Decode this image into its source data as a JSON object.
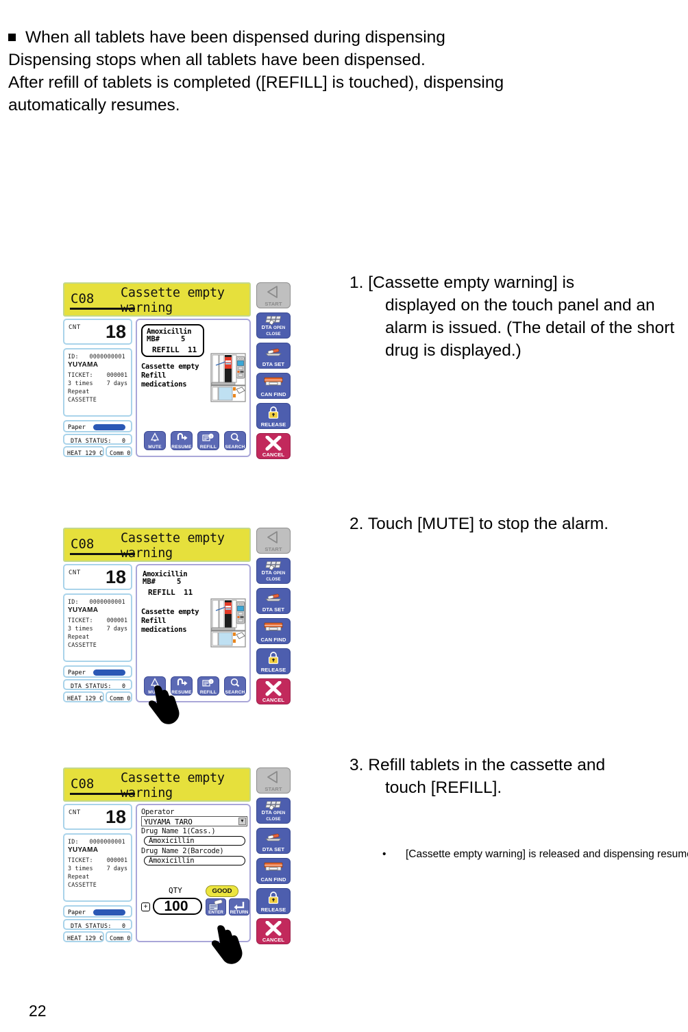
{
  "intro": {
    "bullet_line": "When all tablets have been dispensed during dispensing",
    "line2": "Dispensing stops when all tablets have been dispensed.",
    "line3": "After refill of tablets is completed ([REFILL] is touched), dispensing",
    "line4": "automatically resumes."
  },
  "steps": [
    {
      "number": "1.",
      "first": "[Cassette empty warning] is",
      "rest": "displayed on the touch panel and an alarm is issued.  (The detail of the short drug is displayed.)"
    },
    {
      "number": "2.",
      "first": "Touch [MUTE] to stop the alarm.",
      "rest": ""
    },
    {
      "number": "3.",
      "first": "Refill tablets in the cassette and",
      "rest": "touch [REFILL]."
    }
  ],
  "note": {
    "bullet": "•",
    "text": "[Cassette empty warning] is released and dispensing resumes."
  },
  "screen": {
    "header": {
      "code": "C08",
      "title": "Cassette empty warning"
    },
    "count": {
      "label": "CNT",
      "value": "18"
    },
    "patient": {
      "id_label": "ID:",
      "id_value": "0000000001",
      "name": "YUYAMA",
      "ticket_label": "TICKET:",
      "ticket_value": "000001",
      "times": "3 times",
      "days": "7 days",
      "repeat": "Repeat",
      "cassette": "CASSETTE"
    },
    "status": {
      "paper_label": "Paper",
      "dta_label": "DTA STATUS:",
      "dta_value": "0",
      "heat": "HEAT 129  C",
      "comm": "Comm 0"
    },
    "alert": {
      "drug": "Amoxicillin",
      "mb_label": "MB#",
      "mb_value": "5",
      "refill_label": "REFILL",
      "refill_value": "11",
      "message": "Cassette empty Refill medications"
    },
    "touch_buttons": [
      {
        "label": "MUTE",
        "icon": "bell-icon"
      },
      {
        "label": "RESUME",
        "icon": "resume-arrow-icon"
      },
      {
        "label": "REFILL",
        "icon": "refill-info-icon"
      },
      {
        "label": "SEARCH",
        "icon": "magnifier-icon"
      }
    ],
    "side_buttons": [
      {
        "label": "START",
        "icon": "play-triangle-icon",
        "style": "start"
      },
      {
        "label": "DTA OPEN CLOSE",
        "icon": "dta-open-close-icon",
        "style": "blue"
      },
      {
        "label": "DTA SET",
        "icon": "dta-set-icon",
        "style": "blue"
      },
      {
        "label": "CAN FIND",
        "icon": "can-find-icon",
        "style": "blue"
      },
      {
        "label": "RELEASE",
        "icon": "lock-icon",
        "style": "blue"
      },
      {
        "label": "CANCEL",
        "icon": "x-icon",
        "style": "red"
      }
    ],
    "form": {
      "operator_label": "Operator",
      "operator_value": "YUYAMA TARO",
      "drug1_label": "Drug Name 1(Cass.)",
      "drug1_value": "Amoxicillin",
      "drug2_label": "Drug Name 2(Barcode)",
      "drug2_value": "Amoxicillin",
      "qty_label": "QTY",
      "qty_value": "100",
      "good_badge": "GOOD",
      "plus": "+",
      "enter_label": "ENTER",
      "return_label": "RETURN"
    }
  },
  "colors": {
    "header_yellow": "#e6e03c",
    "header_border": "#c3d88c",
    "panel_blue_border": "#a9d3ea",
    "main_border": "#a9a6d8",
    "button_blue": "#4d5eae",
    "cancel_red": "#c2295c",
    "touch_blue": "#5b69b4",
    "good_yellow": "#ece53f",
    "paper_bar": "#2b58b5"
  },
  "page_number": "22"
}
